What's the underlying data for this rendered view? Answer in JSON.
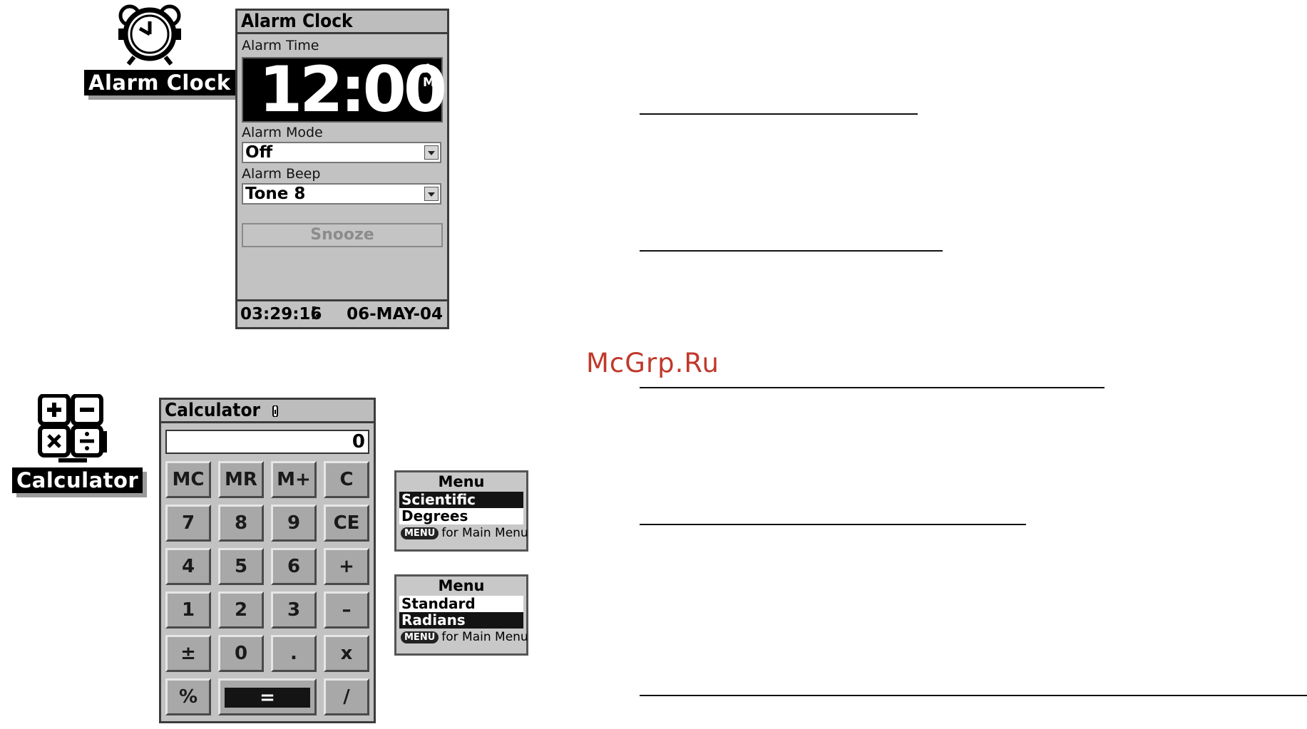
{
  "watermark": "McGrp.Ru",
  "alarm_app": {
    "icon_label": "Alarm Clock",
    "window_title": "Alarm Clock",
    "alarm_time_label": "Alarm Time",
    "alarm_time": "12:00",
    "alarm_ampm": "AM",
    "alarm_mode_label": "Alarm Mode",
    "alarm_mode_value": "Off",
    "alarm_beep_label": "Alarm Beep",
    "alarm_beep_value": "Tone 8",
    "snooze_label": "Snooze",
    "status_time": "03:29:16",
    "status_ampm": "PM",
    "status_date": "06-MAY-04"
  },
  "calculator_app": {
    "icon_label": "Calculator",
    "window_title": "Calculator",
    "display_value": "0",
    "keys": [
      "MC",
      "MR",
      "M+",
      "C",
      "7",
      "8",
      "9",
      "CE",
      "4",
      "5",
      "6",
      "+",
      "1",
      "2",
      "3",
      "–",
      "±",
      "0",
      ".",
      "x",
      "%",
      "=",
      "/"
    ]
  },
  "menu_scientific": {
    "title": "Menu",
    "items": [
      "Scientific",
      "Degrees"
    ],
    "selected": "Scientific",
    "key_label": "MENU",
    "footer": "for Main Menu"
  },
  "menu_standard": {
    "title": "Menu",
    "items": [
      "Standard",
      "Radians"
    ],
    "selected": "Radians",
    "key_label": "MENU",
    "footer": "for Main Menu"
  },
  "colors": {
    "window_bg": "#c2c2c2",
    "border": "#3c3c3c",
    "watermark": "#c0392b",
    "selection": "#141414"
  }
}
